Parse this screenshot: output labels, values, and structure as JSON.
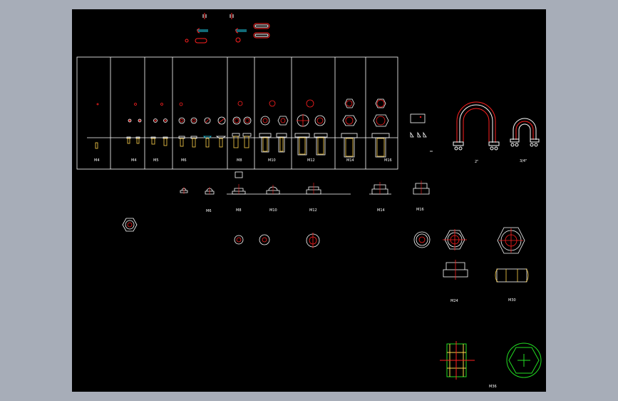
{
  "viewport": {
    "background": "#000000",
    "frame_color": "#a7adb8"
  },
  "colors": {
    "outline": "#ffffff",
    "centerline": "#ff2020",
    "thread": "#ffd24a",
    "nut_face": "#ffffff",
    "cyan": "#22d3ee",
    "green": "#22dd22"
  },
  "table": {
    "labels": [
      "M4",
      "M4",
      "M5",
      "M6",
      "M8",
      "M10",
      "M12",
      "M14",
      "M16"
    ]
  },
  "nut_row": {
    "labels": [
      "M6",
      "M8",
      "M10",
      "M12",
      "M14",
      "M16"
    ]
  },
  "ubolt": {
    "label_large": "2\"",
    "label_small": "3/4\""
  },
  "misc": {
    "label_m24": "M24",
    "label_m30": "M30",
    "label_m36": "M36"
  }
}
